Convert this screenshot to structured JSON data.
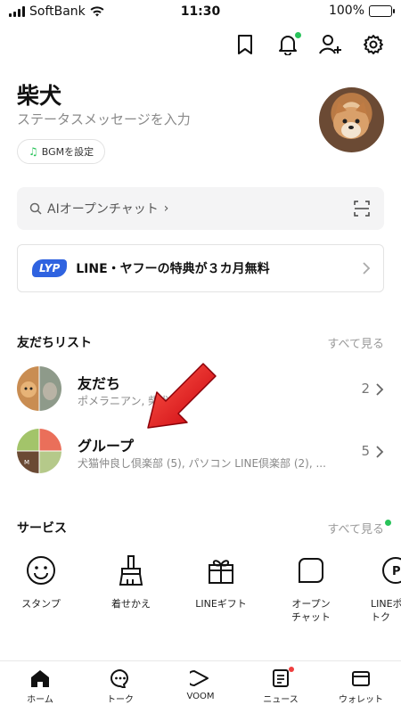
{
  "status_bar": {
    "carrier": "SoftBank",
    "time": "11:30",
    "battery": "100%"
  },
  "top_icons": [
    "bookmark-icon",
    "bell-icon",
    "add-friend-icon",
    "settings-icon"
  ],
  "profile": {
    "name": "柴犬",
    "status_placeholder": "ステータスメッセージを入力",
    "bgm_label": "BGMを設定"
  },
  "search": {
    "placeholder": "AIオープンチャット"
  },
  "banner": {
    "badge": "LYP",
    "text": "LINE・ヤフーの特典が３カ月無料"
  },
  "friends_section": {
    "title": "友だちリスト",
    "see_all": "すべて見る",
    "rows": [
      {
        "title": "友だち",
        "sub": "ポメラニアン, 柴犬",
        "count": "2"
      },
      {
        "title": "グループ",
        "sub": "犬猫仲良し倶楽部 (5), パソコン LINE倶楽部 (2), ...",
        "count": "5"
      }
    ]
  },
  "services_section": {
    "title": "サービス",
    "see_all": "すべて見る",
    "items": [
      {
        "label": "スタンプ",
        "icon": "smile-icon"
      },
      {
        "label": "着せかえ",
        "icon": "brush-icon"
      },
      {
        "label": "LINEギフト",
        "icon": "gift-icon"
      },
      {
        "label": "オープン\nチャット",
        "icon": "open-chat-icon"
      },
      {
        "label": "LINEポケ\nトク",
        "icon": "coupon-icon"
      }
    ]
  },
  "bottom_nav": [
    {
      "label": "ホーム",
      "icon": "home-icon"
    },
    {
      "label": "トーク",
      "icon": "chat-icon"
    },
    {
      "label": "VOOM",
      "icon": "voom-icon"
    },
    {
      "label": "ニュース",
      "icon": "news-icon"
    },
    {
      "label": "ウォレット",
      "icon": "wallet-icon"
    }
  ],
  "colors": {
    "accent_green": "#29c35a",
    "lyp_blue": "#2f63e0",
    "arrow_red": "#e8141c"
  }
}
